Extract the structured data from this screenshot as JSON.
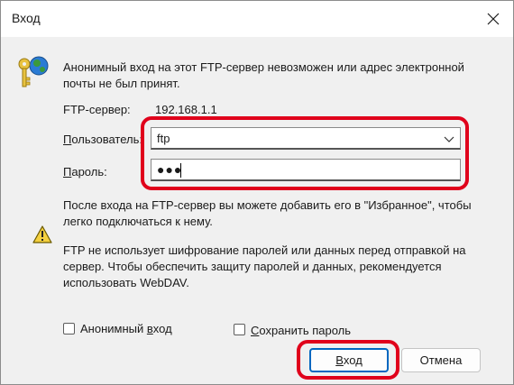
{
  "window": {
    "title": "Вход"
  },
  "message": "Анонимный вход на этот FTP-сервер невозможен или адрес электронной почты не был принят.",
  "server": {
    "label": "FTP-сервер:",
    "value": "192.168.1.1"
  },
  "user": {
    "label_underlined": "П",
    "label_rest": "ользователь:",
    "value": "ftp"
  },
  "password": {
    "label_underlined": "П",
    "label_rest": "ароль:",
    "masked_value": "●●●"
  },
  "info_text": "После входа на FTP-сервер вы можете добавить его в \"Избранное\", чтобы легко подключаться к нему.",
  "warning_text": "FTP не использует шифрование паролей или данных перед отправкой на сервер. Чтобы обеспечить защиту паролей и данных, рекомендуется использовать WebDAV.",
  "anonymous": {
    "label_before": "Анонимный ",
    "label_underlined": "в",
    "label_after": "ход",
    "checked": false
  },
  "save_password": {
    "label_underlined": "С",
    "label_rest": "охранить пароль",
    "checked": false
  },
  "buttons": {
    "login": {
      "label_underlined": "В",
      "label_rest": "ход"
    },
    "cancel": {
      "label": "Отмена"
    }
  },
  "colors": {
    "highlight": "#e0001b",
    "accent": "#0067c0",
    "background": "#f0f0f0"
  },
  "icons": [
    "close-icon",
    "user-key-icon",
    "warning-icon",
    "chevron-down-icon"
  ]
}
